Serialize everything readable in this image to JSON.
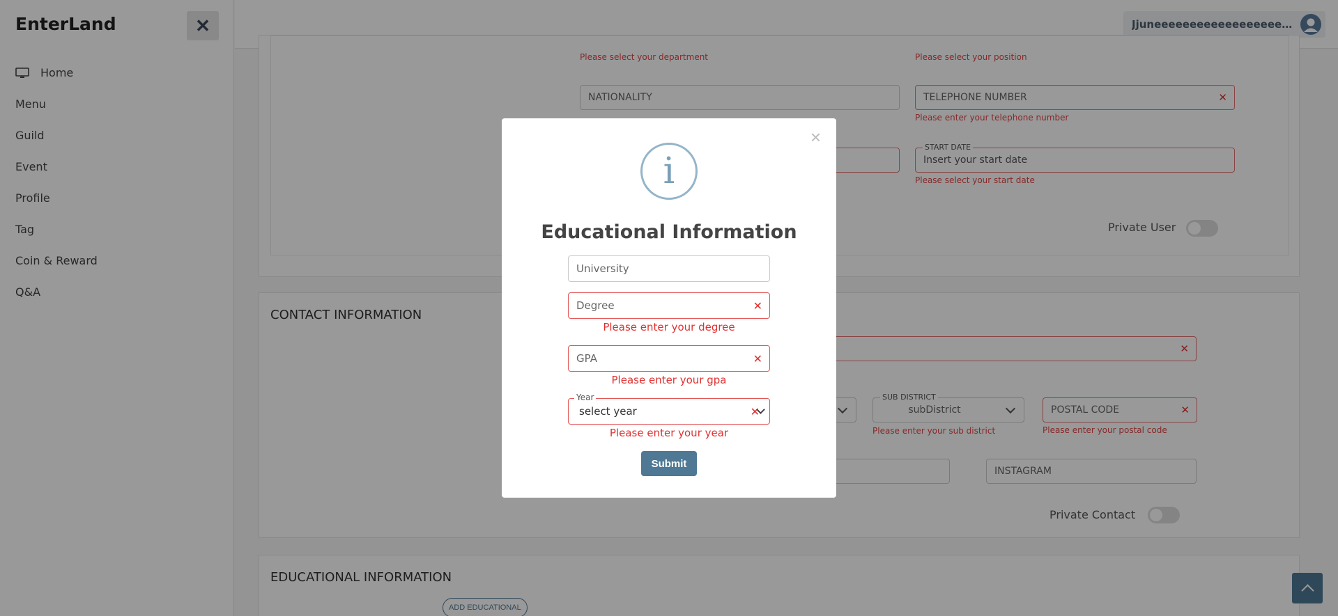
{
  "brand": "EnterLand",
  "sidebar": {
    "items": [
      {
        "label": "Home",
        "icon": "monitor-icon"
      },
      {
        "label": "Menu"
      },
      {
        "label": "Guild"
      },
      {
        "label": "Event"
      },
      {
        "label": "Profile"
      },
      {
        "label": "Tag"
      },
      {
        "label": "Coin & Reward"
      },
      {
        "label": "Q&A"
      }
    ]
  },
  "header": {
    "user_name": "Jjuneeeeeeeeeeeeeeeeeeeeeeeeeeee..."
  },
  "personal": {
    "department_error": "Please select your department",
    "position_error": "Please select your position",
    "nationality_placeholder": "NATIONALITY",
    "telephone_placeholder": "TELEPHONE NUMBER",
    "telephone_error": "Please enter your telephone number",
    "start_date_label": "START DATE",
    "start_date_placeholder": "Insert your start date",
    "start_date_error": "Please select your start date",
    "private_user_label": "Private User"
  },
  "contact": {
    "title": "CONTACT INFORMATION",
    "sub_district_label": "SUB DISTRICT",
    "sub_district_value": "subDistrict",
    "sub_district_error": "Please enter your sub district",
    "postal_code_placeholder": "POSTAL CODE",
    "postal_code_error": "Please enter your postal code",
    "instagram_placeholder": "INSTAGRAM",
    "private_contact_label": "Private Contact"
  },
  "education": {
    "title": "EDUCATIONAL INFORMATION",
    "add_button": "ADD EDUCATIONAL"
  },
  "modal": {
    "title": "Educational Information",
    "university_placeholder": "University",
    "degree_placeholder": "Degree",
    "degree_error": "Please enter your degree",
    "gpa_placeholder": "GPA",
    "gpa_error": "Please enter your gpa",
    "year_label": "Year",
    "year_value": "select year",
    "year_error": "Please enter your year",
    "submit_label": "Submit",
    "close_symbol": "×",
    "info_symbol": "i"
  },
  "colors": {
    "accent": "#4f7894",
    "error": "#e03131"
  }
}
